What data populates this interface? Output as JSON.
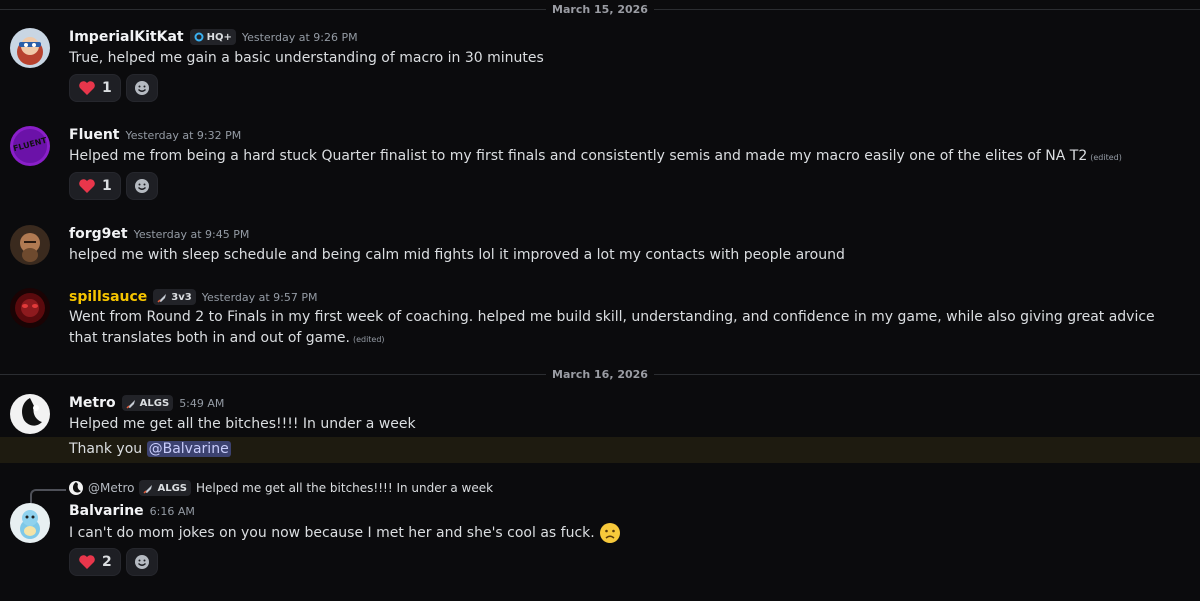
{
  "dividers": [
    "March 15, 2026",
    "March 16, 2026"
  ],
  "messages": [
    {
      "author": "ImperialKitKat",
      "tag": "HQ+",
      "timestamp": "Yesterday at 9:26 PM",
      "text": "True, helped me gain a basic understanding of macro in 30 minutes",
      "reaction_count": "1"
    },
    {
      "author": "Fluent",
      "timestamp": "Yesterday at 9:32 PM",
      "text": "Helped me from being a hard stuck Quarter finalist to my first finals and consistently semis and made my macro easily one of the elites of NA T2",
      "edited": "(edited)",
      "reaction_count": "1",
      "avatar_text": "FLUENT"
    },
    {
      "author": "forg9et",
      "timestamp": "Yesterday at 9:45 PM",
      "text": "helped me with sleep schedule and being calm mid fights lol it improved a lot my contacts with people around"
    },
    {
      "author": "spillsauce",
      "tag": "3v3",
      "timestamp": "Yesterday at 9:57 PM",
      "text": "Went from Round 2 to Finals in my first week of coaching.  helped me build skill, understanding, and confidence in my game, while also giving great advice that translates both in and out of game.",
      "edited": "(edited)",
      "name_color": "#f5c400"
    },
    {
      "author": "Metro",
      "tag": "ALGS",
      "timestamp": "5:49 AM",
      "text": "Helped me get all the bitches!!!!  In under a week",
      "text2_prefix": "Thank you ",
      "mention": "@Balvarine"
    },
    {
      "author": "Balvarine",
      "timestamp": "6:16 AM",
      "reply_name": "@Metro",
      "reply_tag": "ALGS",
      "reply_text": "Helped me get all the bitches!!!!  In under a week",
      "text": "I can't do mom jokes on you now because I met her and she's cool as fuck.",
      "reaction_count": "2"
    }
  ],
  "icons": {
    "reaction_emoji": "red-heart",
    "add_reaction": "smiley-add-reaction",
    "inline_emoji": "slightly-frowning-face",
    "hq_icon": "blue-ring-badge",
    "rocket_icon": "rocket-badge"
  },
  "colors": {
    "background": "#0b0b0d",
    "heart": "#e8364b",
    "mention_bg": "#3c4270",
    "highlight": "#1e1b10"
  }
}
